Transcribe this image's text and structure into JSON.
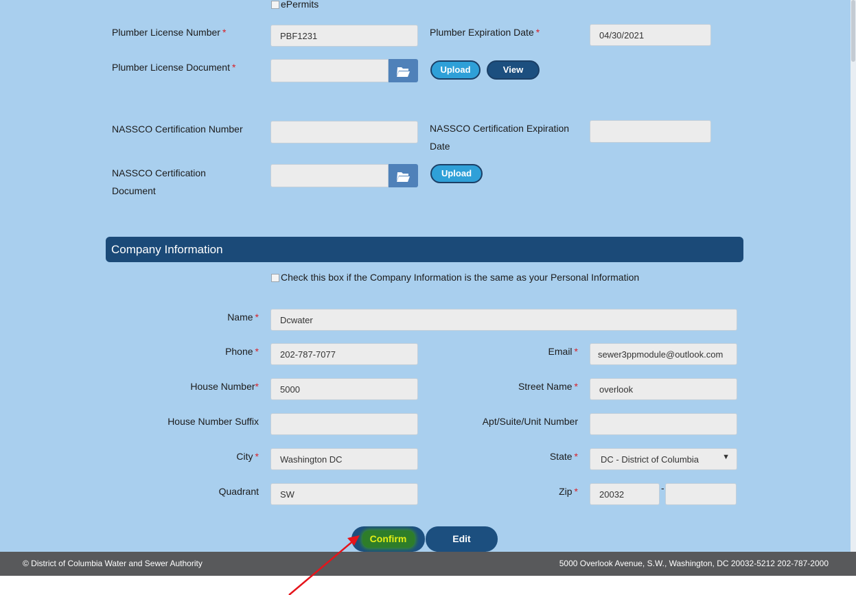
{
  "epermits_label": "ePermits",
  "plumber": {
    "license_number_label": "Plumber License Number",
    "license_number_value": "PBF1231",
    "expiration_label": "Plumber Expiration Date",
    "expiration_value": "04/30/2021",
    "document_label": "Plumber License Document",
    "upload_label": "Upload",
    "view_label": "View"
  },
  "nassco": {
    "number_label": "NASSCO Certification Number",
    "expiration_label_line1": "NASSCO Certification Expiration",
    "expiration_label_line2": "Date",
    "document_label_line1": "NASSCO Certification",
    "document_label_line2": "Document",
    "upload_label": "Upload"
  },
  "company": {
    "section_title": "Company Information",
    "same_as_personal_label": "Check this box if the Company Information is the same as your Personal Information",
    "name_label": "Name",
    "name_value": "Dcwater",
    "phone_label": "Phone",
    "phone_value": "202-787-7077",
    "email_label": "Email",
    "email_value": "sewer3ppmodule@outlook.com",
    "house_number_label": "House Number",
    "house_number_value": "5000",
    "street_name_label": "Street Name",
    "street_name_value": "overlook",
    "house_suffix_label": "House Number Suffix",
    "house_suffix_value": "",
    "apt_label": "Apt/Suite/Unit Number",
    "apt_value": "",
    "city_label": "City",
    "city_value": "Washington DC",
    "state_label": "State",
    "state_value": "DC - District of Columbia",
    "quadrant_label": "Quadrant",
    "quadrant_value": "SW",
    "zip_label": "Zip",
    "zip_value": "20032",
    "zip_ext_value": "",
    "zip_separator": "-"
  },
  "actions": {
    "confirm_label": "Confirm",
    "edit_label": "Edit"
  },
  "footer": {
    "left_text": "© District of Columbia Water and Sewer Authority",
    "right_text": "5000 Overlook Avenue, S.W., Washington, DC 20032-5212 202-787-2000"
  },
  "required_mark": "*",
  "colors": {
    "page_bg": "#a9cfee",
    "section_header": "#1b4a78",
    "required": "#d81f26",
    "annotation_arrow": "#e5141b",
    "highlight": "#e4ef16"
  }
}
